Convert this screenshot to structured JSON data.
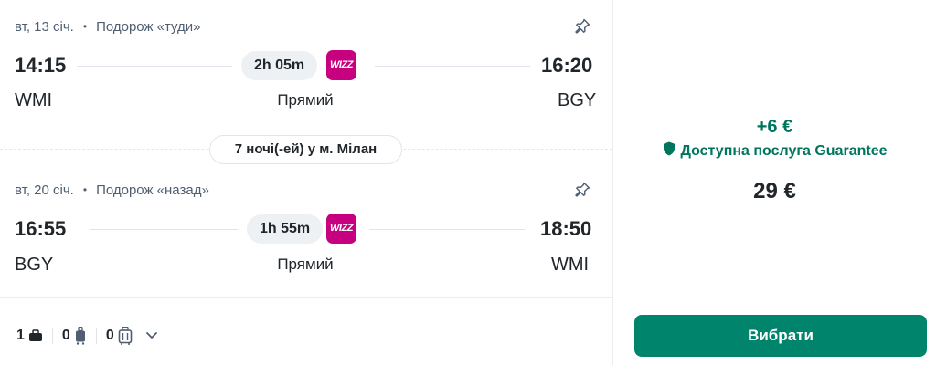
{
  "outbound": {
    "date": "вт, 13 січ.",
    "direction": "Подорож «туди»",
    "depart_time": "14:15",
    "arrive_time": "16:20",
    "duration": "2h 05m",
    "carrier_logo_text": "WIZZ",
    "depart_code": "WMI",
    "arrive_code": "BGY",
    "stops": "Прямий"
  },
  "stay": {
    "label": "7 ночі(-ей) у м. Мілан"
  },
  "inbound": {
    "date": "вт, 20 січ.",
    "direction": "Подорож «назад»",
    "depart_time": "16:55",
    "arrive_time": "18:50",
    "duration": "1h 55m",
    "carrier_logo_text": "WIZZ",
    "depart_code": "BGY",
    "arrive_code": "WMI",
    "stops": "Прямий"
  },
  "baggage": {
    "personal_item": "1",
    "cabin_bag": "0",
    "checked_bag": "0"
  },
  "pricing": {
    "extra": "+6 €",
    "guarantee_label": "Доступна послуга Guarantee",
    "price": "29 €",
    "select_label": "Вибрати"
  },
  "colors": {
    "accent_green": "#00856c",
    "guarantee_green": "#00755d",
    "carrier_magenta": "#c6007e"
  },
  "icons": [
    "pin-icon",
    "personal-item-icon",
    "cabin-bag-icon",
    "checked-bag-icon",
    "chevron-down-icon",
    "shield-icon"
  ]
}
